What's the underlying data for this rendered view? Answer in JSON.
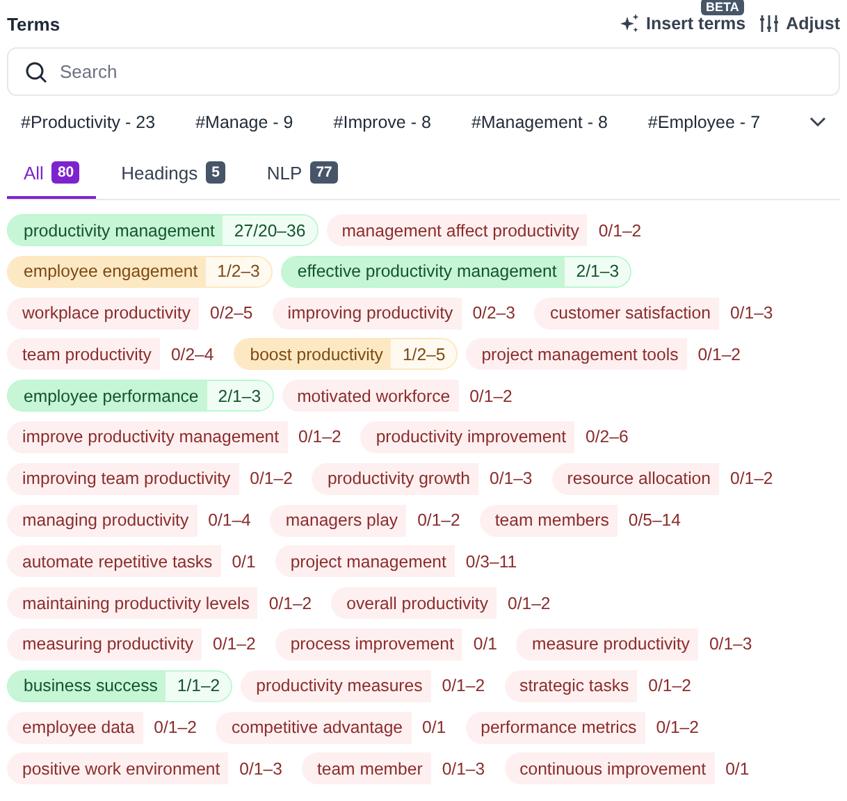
{
  "header": {
    "title": "Terms",
    "insert_label": "Insert terms",
    "beta_badge": "BETA",
    "adjust_label": "Adjust"
  },
  "search": {
    "placeholder": "Search"
  },
  "hashtags": [
    "#Productivity - 23",
    "#Manage - 9",
    "#Improve - 8",
    "#Management - 8",
    "#Employee - 7"
  ],
  "tabs": [
    {
      "label": "All",
      "count": "80",
      "selected": true
    },
    {
      "label": "Headings",
      "count": "5",
      "selected": false
    },
    {
      "label": "NLP",
      "count": "77",
      "selected": false
    }
  ],
  "term_rows": [
    [
      {
        "term": "productivity management",
        "count": "27/20–36",
        "kind": "good"
      },
      {
        "term": "management affect productivity",
        "count": "0/1–2",
        "kind": "missing"
      }
    ],
    [
      {
        "term": "employee engagement",
        "count": "1/2–3",
        "kind": "partial"
      },
      {
        "term": "effective productivity management",
        "count": "2/1–3",
        "kind": "good"
      }
    ],
    [
      {
        "term": "workplace productivity",
        "count": "0/2–5",
        "kind": "missing"
      },
      {
        "term": "improving productivity",
        "count": "0/2–3",
        "kind": "missing"
      },
      {
        "term": "customer satisfaction",
        "count": "0/1–3",
        "kind": "missing"
      }
    ],
    [
      {
        "term": "team productivity",
        "count": "0/2–4",
        "kind": "missing"
      },
      {
        "term": "boost productivity",
        "count": "1/2–5",
        "kind": "partial"
      },
      {
        "term": "project management tools",
        "count": "0/1–2",
        "kind": "missing"
      }
    ],
    [
      {
        "term": "employee performance",
        "count": "2/1–3",
        "kind": "good"
      },
      {
        "term": "motivated workforce",
        "count": "0/1–2",
        "kind": "missing"
      }
    ],
    [
      {
        "term": "improve productivity management",
        "count": "0/1–2",
        "kind": "missing"
      },
      {
        "term": "productivity improvement",
        "count": "0/2–6",
        "kind": "missing"
      }
    ],
    [
      {
        "term": "improving team productivity",
        "count": "0/1–2",
        "kind": "missing"
      },
      {
        "term": "productivity growth",
        "count": "0/1–3",
        "kind": "missing"
      },
      {
        "term": "resource allocation",
        "count": "0/1–2",
        "kind": "missing"
      }
    ],
    [
      {
        "term": "managing productivity",
        "count": "0/1–4",
        "kind": "missing"
      },
      {
        "term": "managers play",
        "count": "0/1–2",
        "kind": "missing"
      },
      {
        "term": "team members",
        "count": "0/5–14",
        "kind": "missing"
      }
    ],
    [
      {
        "term": "automate repetitive tasks",
        "count": "0/1",
        "kind": "missing"
      },
      {
        "term": "project management",
        "count": "0/3–11",
        "kind": "missing"
      }
    ],
    [
      {
        "term": "maintaining productivity levels",
        "count": "0/1–2",
        "kind": "missing"
      },
      {
        "term": "overall productivity",
        "count": "0/1–2",
        "kind": "missing"
      }
    ],
    [
      {
        "term": "measuring productivity",
        "count": "0/1–2",
        "kind": "missing"
      },
      {
        "term": "process improvement",
        "count": "0/1",
        "kind": "missing"
      },
      {
        "term": "measure productivity",
        "count": "0/1–3",
        "kind": "missing"
      }
    ],
    [
      {
        "term": "business success",
        "count": "1/1–2",
        "kind": "good"
      },
      {
        "term": "productivity measures",
        "count": "0/1–2",
        "kind": "missing"
      },
      {
        "term": "strategic tasks",
        "count": "0/1–2",
        "kind": "missing"
      }
    ],
    [
      {
        "term": "employee data",
        "count": "0/1–2",
        "kind": "missing"
      },
      {
        "term": "competitive advantage",
        "count": "0/1",
        "kind": "missing"
      },
      {
        "term": "performance metrics",
        "count": "0/1–2",
        "kind": "missing"
      }
    ],
    [
      {
        "term": "positive work environment",
        "count": "0/1–3",
        "kind": "missing"
      },
      {
        "term": "team member",
        "count": "0/1–3",
        "kind": "missing"
      },
      {
        "term": "continuous improvement",
        "count": "0/1",
        "kind": "missing"
      }
    ]
  ]
}
